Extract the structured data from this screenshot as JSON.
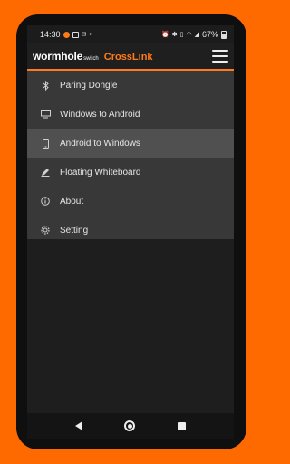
{
  "statusbar": {
    "time": "14:30",
    "battery": "67%"
  },
  "appbar": {
    "brand_main": "wormhole",
    "brand_sub": "switch",
    "product": "CrossLink"
  },
  "drawer": {
    "items": [
      {
        "label": "Paring Dongle",
        "icon": "bluetooth-icon",
        "active": false
      },
      {
        "label": "Windows to Android",
        "icon": "monitor-icon",
        "active": false
      },
      {
        "label": "Android to Windows",
        "icon": "phone-icon",
        "active": true
      },
      {
        "label": "Floating Whiteboard",
        "icon": "pen-icon",
        "active": false
      },
      {
        "label": "About",
        "icon": "info-icon",
        "active": false
      },
      {
        "label": "Setting",
        "icon": "gear-icon",
        "active": false
      }
    ]
  },
  "colors": {
    "accent": "#ff7a1a",
    "background": "#ff6a00"
  }
}
